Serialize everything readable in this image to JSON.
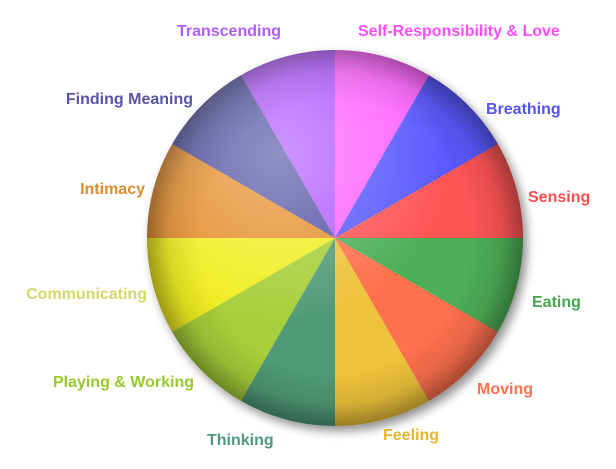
{
  "wheel": {
    "segments": [
      {
        "label": "Self-Responsibility & Love",
        "color": "#ff66ff",
        "label_color": "#ff4dff"
      },
      {
        "label": "Breathing",
        "color": "#5a5aff",
        "label_color": "#5555ee"
      },
      {
        "label": "Sensing",
        "color": "#ff5555",
        "label_color": "#ff4d4d"
      },
      {
        "label": "Eating",
        "color": "#4daf57",
        "label_color": "#45a84f"
      },
      {
        "label": "Moving",
        "color": "#ff704d",
        "label_color": "#ff704d"
      },
      {
        "label": "Feeling",
        "color": "#eec23a",
        "label_color": "#e6b52e"
      },
      {
        "label": "Thinking",
        "color": "#4f9a78",
        "label_color": "#4f9a78"
      },
      {
        "label": "Playing & Working",
        "color": "#a6cf3a",
        "label_color": "#98c82e"
      },
      {
        "label": "Communicating",
        "color": "#f0ee22",
        "label_color": "#d4d866"
      },
      {
        "label": "Intimacy",
        "color": "#e69030",
        "label_color": "#e08a2e"
      },
      {
        "label": "Finding Meaning",
        "color": "#5656a6",
        "label_color": "#5656a6"
      },
      {
        "label": "Transcending",
        "color": "#b35cff",
        "label_color": "#b35cff"
      }
    ]
  }
}
